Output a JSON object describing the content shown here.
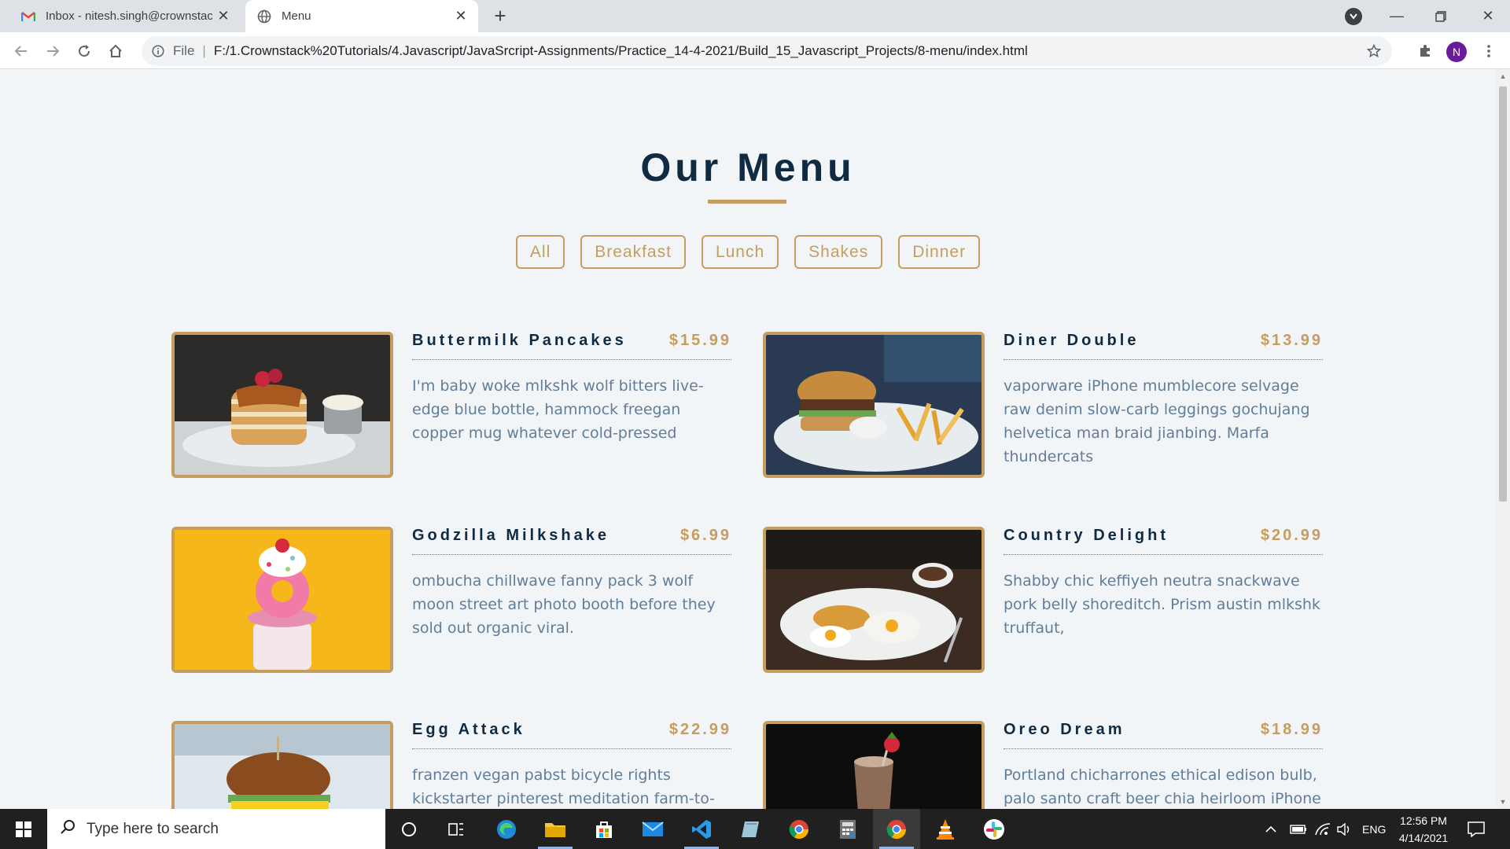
{
  "browser": {
    "tabs": [
      {
        "title": "Inbox - nitesh.singh@crownstack",
        "icon": "gmail-icon",
        "active": false
      },
      {
        "title": "Menu",
        "icon": "globe-icon",
        "active": true
      }
    ],
    "address": {
      "scheme": "File",
      "url": "F:/1.Crownstack%20Tutorials/4.Javascript/JavaSrcript-Assignments/Practice_14-4-2021/Build_15_Javascript_Projects/8-menu/index.html"
    },
    "profile_initial": "N"
  },
  "page": {
    "title": "Our Menu",
    "filters": [
      "All",
      "Breakfast",
      "Lunch",
      "Shakes",
      "Dinner"
    ],
    "items": [
      {
        "name": "Buttermilk Pancakes",
        "price": "$15.99",
        "desc": "I'm baby woke mlkshk wolf bitters live-edge blue bottle, hammock freegan copper mug whatever cold-pressed",
        "photo": "pancakes"
      },
      {
        "name": "Diner Double",
        "price": "$13.99",
        "desc": "vaporware iPhone mumblecore selvage raw denim slow-carb leggings gochujang helvetica man braid jianbing. Marfa thundercats",
        "photo": "burger-fries"
      },
      {
        "name": "Godzilla Milkshake",
        "price": "$6.99",
        "desc": "ombucha chillwave fanny pack 3 wolf moon street art photo booth before they sold out organic viral.",
        "photo": "milkshake"
      },
      {
        "name": "Country Delight",
        "price": "$20.99",
        "desc": "Shabby chic keffiyeh neutra snackwave pork belly shoreditch. Prism austin mlkshk truffaut,",
        "photo": "eggs-plate"
      },
      {
        "name": "Egg Attack",
        "price": "$22.99",
        "desc": "franzen vegan pabst bicycle rights kickstarter pinterest meditation farm-to-",
        "photo": "egg-burger"
      },
      {
        "name": "Oreo Dream",
        "price": "$18.99",
        "desc": "Portland chicharrones ethical edison bulb, palo santo craft beer chia heirloom iPhone",
        "photo": "oreo-shake"
      }
    ],
    "colors": {
      "accent": "#c59d5f",
      "heading": "#102a42",
      "text": "#617d98",
      "background": "#f1f5f8"
    }
  },
  "taskbar": {
    "search_placeholder": "Type here to search",
    "language": "ENG",
    "time": "12:56 PM",
    "date": "4/14/2021"
  }
}
